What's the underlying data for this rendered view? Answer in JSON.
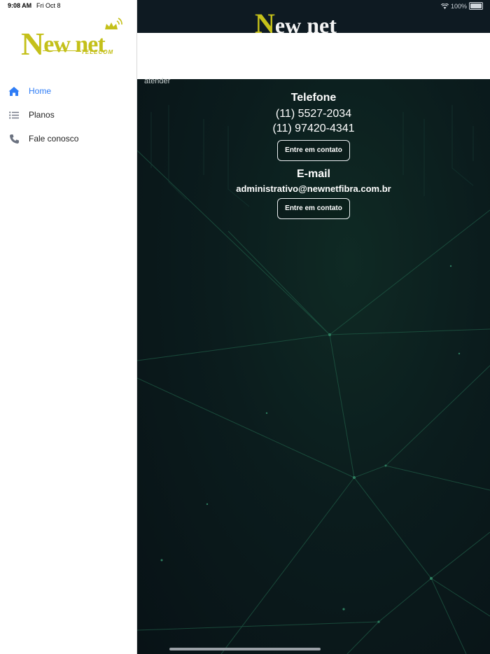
{
  "status_bar": {
    "time": "9:08 AM",
    "date": "Fri Oct 8",
    "battery": "100%"
  },
  "sidebar": {
    "logo": {
      "text_main": "ew net",
      "text_n": "N",
      "text_sub": "TELECOM"
    },
    "items": [
      {
        "label": "Home",
        "icon": "home-icon",
        "active": true
      },
      {
        "label": "Planos",
        "icon": "list-icon",
        "active": false
      },
      {
        "label": "Fale conosco",
        "icon": "phone-icon",
        "active": false
      }
    ]
  },
  "main": {
    "brand": {
      "n": "N",
      "rest": "ew net"
    },
    "partial_text": "atender",
    "phone": {
      "title": "Telefone",
      "numbers": [
        "(11) 5527-2034",
        "(11) 97420-4341"
      ],
      "button": "Entre em contato"
    },
    "email": {
      "title": "E-mail",
      "address": "administrativo@newnetfibra.com.br",
      "button": "Entre em contato"
    }
  },
  "colors": {
    "accent": "#2f7df6",
    "brand_yellow": "#c4c01a",
    "background": "#0b1c1d"
  }
}
